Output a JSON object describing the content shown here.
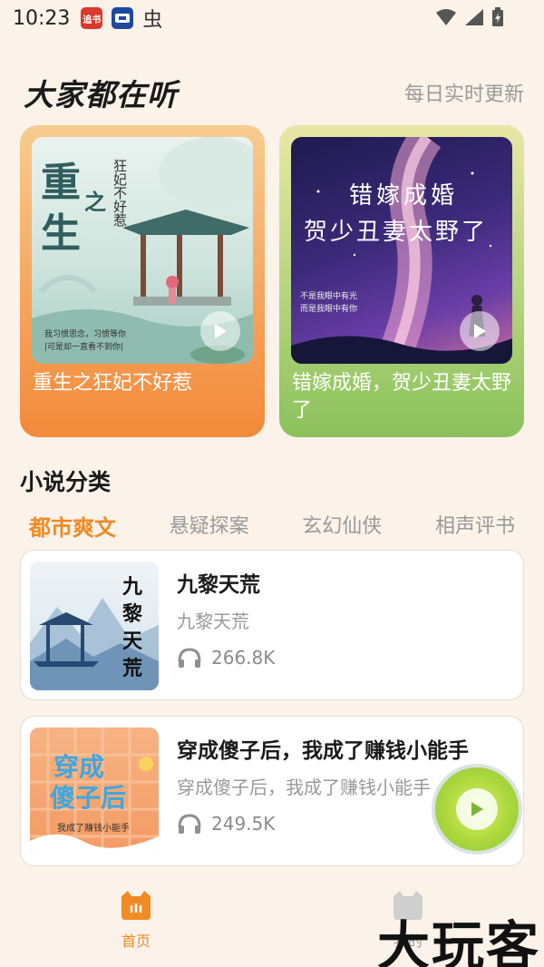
{
  "status": {
    "time": "10:23",
    "app_icons": [
      {
        "name": "zhuishu-app-icon",
        "label": "追书",
        "color": "#d93a2b"
      },
      {
        "name": "ticket-app-icon",
        "label": "",
        "color": "#1d4aa0"
      },
      {
        "name": "bug-icon",
        "label": "虫",
        "color": "#ffffff"
      }
    ]
  },
  "header": {
    "title": "大家都在听",
    "subtitle": "每日实时更新"
  },
  "featured": [
    {
      "title": "重生之狂妃不好惹",
      "cover_big": "重",
      "cover_big2": "生",
      "cover_small": "之",
      "cover_side": "狂妃不好惹",
      "cover_caption": "我习惯思念，习惯等你",
      "cover_caption2": "|可是却一直看不到你|"
    },
    {
      "title": "错嫁成婚，贺少丑妻太野了",
      "cover_line1": "错嫁成婚",
      "cover_line2": "贺少丑妻太野了",
      "cover_note1": "不是我眼中有光",
      "cover_note2": "而是我眼中有你"
    }
  ],
  "category": {
    "title": "小说分类",
    "tabs": [
      "都市爽文",
      "悬疑探案",
      "玄幻仙侠",
      "相声评书"
    ],
    "active_index": 0
  },
  "books": [
    {
      "title": "九黎天荒",
      "author": "九黎天荒",
      "plays": "266.8K",
      "cover_text": [
        "九",
        "黎",
        "天",
        "荒"
      ]
    },
    {
      "title": "穿成傻子后，我成了赚钱小能手",
      "author": "穿成傻子后，我成了赚钱小能手",
      "plays": "249.5K",
      "cover_text1": "穿成",
      "cover_text2": "傻子后",
      "cover_text3": "我成了赚钱小能手"
    }
  ],
  "nav": {
    "home_label": "首页",
    "mine_label": "我的"
  },
  "watermark": "大玩客",
  "colors": {
    "accent": "#f08a24",
    "background": "#fbf2ea"
  }
}
